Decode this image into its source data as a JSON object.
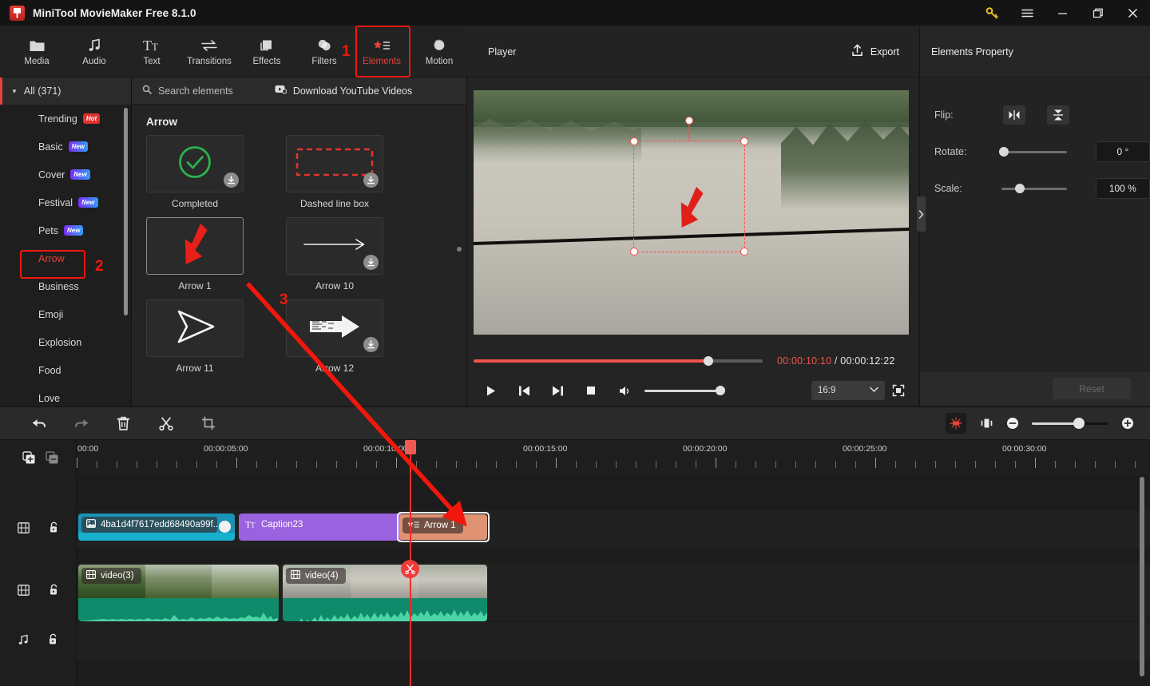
{
  "window": {
    "title": "MiniTool MovieMaker Free 8.1.0",
    "controls": [
      {
        "name": "key-icon",
        "label": "Activate"
      },
      {
        "name": "menu-icon",
        "label": "Menu"
      },
      {
        "name": "minimize-icon",
        "label": "Minimize"
      },
      {
        "name": "maximize-icon",
        "label": "Maximize"
      },
      {
        "name": "close-icon",
        "label": "Close"
      }
    ]
  },
  "toolbar": {
    "items": [
      {
        "label": "Media",
        "icon": "folder-icon",
        "active": false
      },
      {
        "label": "Audio",
        "icon": "music-note-icon",
        "active": false
      },
      {
        "label": "Text",
        "icon": "text-tt-icon",
        "active": false
      },
      {
        "label": "Transitions",
        "icon": "transition-arrows-icon",
        "active": false
      },
      {
        "label": "Effects",
        "icon": "effects-squares-icon",
        "active": false
      },
      {
        "label": "Filters",
        "icon": "filters-circles-icon",
        "active": false
      },
      {
        "label": "Elements",
        "icon": "elements-star-icon",
        "active": true
      },
      {
        "label": "Motion",
        "icon": "motion-ball-icon",
        "active": false
      }
    ]
  },
  "annotations": [
    {
      "id": "1",
      "text": "1"
    },
    {
      "id": "2",
      "text": "2"
    },
    {
      "id": "3",
      "text": "3"
    }
  ],
  "sidebar": {
    "all_label": "All (371)",
    "items": [
      {
        "label": "Trending",
        "badge": "Hot",
        "badge_type": "hot",
        "selected": false
      },
      {
        "label": "Basic",
        "badge": "New",
        "badge_type": "new",
        "selected": false
      },
      {
        "label": "Cover",
        "badge": "New",
        "badge_type": "new",
        "selected": false
      },
      {
        "label": "Festival",
        "badge": "New",
        "badge_type": "new",
        "selected": false
      },
      {
        "label": "Pets",
        "badge": "New",
        "badge_type": "new",
        "selected": false
      },
      {
        "label": "Arrow",
        "badge": "",
        "badge_type": "",
        "selected": true
      },
      {
        "label": "Business",
        "badge": "",
        "badge_type": "",
        "selected": false
      },
      {
        "label": "Emoji",
        "badge": "",
        "badge_type": "",
        "selected": false
      },
      {
        "label": "Explosion",
        "badge": "",
        "badge_type": "",
        "selected": false
      },
      {
        "label": "Food",
        "badge": "",
        "badge_type": "",
        "selected": false
      },
      {
        "label": "Love",
        "badge": "",
        "badge_type": "",
        "selected": false
      }
    ]
  },
  "browser": {
    "search_placeholder": "Search elements",
    "youtube_label": "Download YouTube Videos",
    "section_title": "Arrow",
    "items": [
      {
        "label": "Completed",
        "icon": "check-circle-icon",
        "downloadable": true,
        "selected": false
      },
      {
        "label": "Dashed line box",
        "icon": "dashed-box-icon",
        "downloadable": true,
        "selected": false
      },
      {
        "label": "Arrow 1",
        "icon": "red-down-arrow-icon",
        "downloadable": false,
        "selected": true
      },
      {
        "label": "Arrow 10",
        "icon": "thin-right-arrow-icon",
        "downloadable": true,
        "selected": false
      },
      {
        "label": "Arrow 11",
        "icon": "outline-paper-plane-icon",
        "downloadable": false,
        "selected": false
      },
      {
        "label": "Arrow 12",
        "icon": "textured-right-arrow-icon",
        "downloadable": true,
        "selected": false
      }
    ]
  },
  "player": {
    "title": "Player",
    "export_label": "Export",
    "current_time": "00:00:10:10",
    "separator": "/",
    "total_time": "00:00:12:22",
    "progress_percent": 81,
    "volume_percent": 100,
    "aspect_ratio": "16:9",
    "controls": [
      {
        "name": "play-button"
      },
      {
        "name": "previous-frame-button"
      },
      {
        "name": "next-frame-button"
      },
      {
        "name": "stop-button"
      },
      {
        "name": "volume-button"
      }
    ]
  },
  "properties": {
    "title": "Elements Property",
    "flip_label": "Flip:",
    "flip_horizontal_name": "flip-horizontal-button",
    "flip_vertical_name": "flip-vertical-button",
    "rotate_label": "Rotate:",
    "rotate_value": "0 °",
    "rotate_percent": 0,
    "scale_label": "Scale:",
    "scale_value": "100 %",
    "scale_percent": 25,
    "reset_label": "Reset"
  },
  "timeline": {
    "tools": [
      {
        "name": "undo-button"
      },
      {
        "name": "redo-button"
      },
      {
        "name": "delete-button"
      },
      {
        "name": "split-button"
      },
      {
        "name": "crop-button"
      }
    ],
    "right_tools": [
      {
        "name": "auto-fit-button"
      },
      {
        "name": "keyframe-button"
      },
      {
        "name": "zoom-out-button"
      },
      {
        "name": "zoom-in-button"
      }
    ],
    "zoom_percent": 55,
    "ruler_labels": [
      "00:00",
      "00:00:05:00",
      "00:00:10:00",
      "00:00:15:00",
      "00:00:20:00",
      "00:00:25:00",
      "00:00:30:00"
    ],
    "tracks": [
      {
        "type": "overlay",
        "head_icons": [
          "film-strip-icon",
          "unlock-icon"
        ],
        "clips": [
          {
            "label": "4ba1d4f7617edd68490a99f...",
            "kind": "image",
            "icon": "image-icon",
            "selected": false
          },
          {
            "label": "Caption23",
            "kind": "caption",
            "icon": "text-tt-icon",
            "selected": false
          },
          {
            "label": "Arrow 1",
            "kind": "element",
            "icon": "elements-star-icon",
            "selected": true
          }
        ]
      },
      {
        "type": "video",
        "head_icons": [
          "film-strip-icon",
          "unlock-icon"
        ],
        "clips": [
          {
            "label": "video(3)",
            "kind": "video",
            "icon": "film-strip-icon",
            "selected": false
          },
          {
            "label": "video(4)",
            "kind": "video",
            "icon": "film-strip-icon",
            "selected": false
          }
        ]
      },
      {
        "type": "audio",
        "head_icons": [
          "music-note-icon",
          "unlock-icon"
        ],
        "clips": []
      }
    ]
  }
}
